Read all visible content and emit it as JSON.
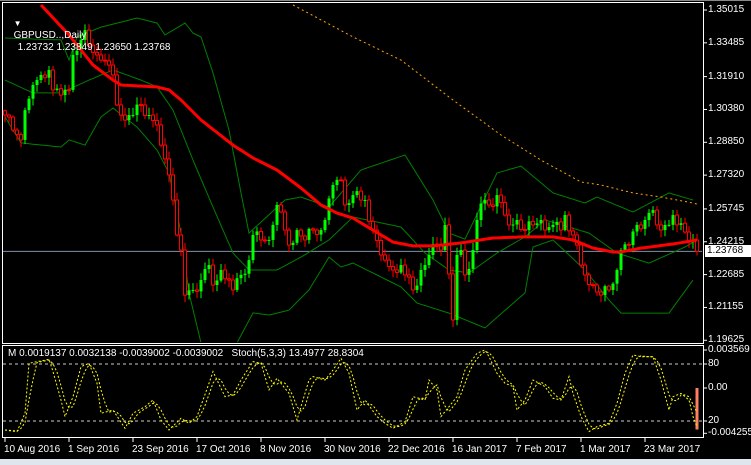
{
  "header": {
    "symbol": "GBPUSD..,Daily",
    "ohlc": "1.23732 1.23849 1.23650 1.23768",
    "menu_icon": "triangle-down-icon"
  },
  "indicator_label": "M 0.0019137 0.0032138 -0.0039002 -0.0039002   Stoch(5,3,3) 13.4977 28.8304",
  "current_price": "1.23768",
  "colors": {
    "bull": "#00ff00",
    "bear": "#ff0000",
    "ma": "#ff0000",
    "bands": "#008000",
    "ma_long": "#ffa500",
    "stoch": "#ffff00",
    "macd_hist": "#ff8060",
    "price_line": "#8090a8"
  },
  "chart_data": [
    {
      "type": "candlestick",
      "title": "GBPUSD..,Daily",
      "x_unit": "bar index (0 = 10 Aug 2016, 173 = last bar)",
      "ylim": [
        1.19625,
        1.35015
      ],
      "y_ticks": [
        "1.35015",
        "1.33485",
        "1.31910",
        "1.30380",
        "1.28850",
        "1.27320",
        "1.25745",
        "1.24215",
        "1.22685",
        "1.21155",
        "1.19625"
      ],
      "x_tick_labels": [
        "10 Aug 2016",
        "1 Sep 2016",
        "23 Sep 2016",
        "17 Oct 2016",
        "8 Nov 2016",
        "30 Nov 2016",
        "22 Dec 2016",
        "16 Jan 2017",
        "7 Feb 2017",
        "1 Mar 2017",
        "23 Mar 2017"
      ],
      "close_keypoints": [
        [
          0,
          1.3012
        ],
        [
          2,
          1.2942
        ],
        [
          4,
          1.2896
        ],
        [
          5,
          1.3035
        ],
        [
          7,
          1.3152
        ],
        [
          8,
          1.3175
        ],
        [
          11,
          1.3222
        ],
        [
          12,
          1.3129
        ],
        [
          14,
          1.3105
        ],
        [
          16,
          1.3129
        ],
        [
          17,
          1.3292
        ],
        [
          19,
          1.3362
        ],
        [
          20,
          1.3408
        ],
        [
          21,
          1.3338
        ],
        [
          23,
          1.3292
        ],
        [
          24,
          1.3268
        ],
        [
          26,
          1.3245
        ],
        [
          27,
          1.3199
        ],
        [
          28,
          1.3059
        ],
        [
          29,
          1.3012
        ],
        [
          31,
          1.3012
        ],
        [
          32,
          1.3012
        ],
        [
          34,
          1.3059
        ],
        [
          36,
          1.3012
        ],
        [
          38,
          1.2966
        ],
        [
          39,
          1.2872
        ],
        [
          41,
          1.2733
        ],
        [
          42,
          1.2616
        ],
        [
          43,
          1.2453
        ],
        [
          44,
          1.2383
        ],
        [
          45,
          1.2173
        ],
        [
          47,
          1.2197
        ],
        [
          49,
          1.2243
        ],
        [
          51,
          1.2313
        ],
        [
          52,
          1.222
        ],
        [
          54,
          1.229
        ],
        [
          56,
          1.2243
        ],
        [
          57,
          1.2197
        ],
        [
          59,
          1.2267
        ],
        [
          61,
          1.2336
        ],
        [
          62,
          1.2453
        ],
        [
          64,
          1.243
        ],
        [
          66,
          1.243
        ],
        [
          67,
          1.25
        ],
        [
          68,
          1.2593
        ],
        [
          70,
          1.2476
        ],
        [
          71,
          1.2406
        ],
        [
          73,
          1.2476
        ],
        [
          75,
          1.243
        ],
        [
          77,
          1.2476
        ],
        [
          79,
          1.2476
        ],
        [
          80,
          1.2523
        ],
        [
          82,
          1.2686
        ],
        [
          84,
          1.2709
        ],
        [
          85,
          1.2593
        ],
        [
          87,
          1.2639
        ],
        [
          89,
          1.2616
        ],
        [
          90,
          1.2616
        ],
        [
          92,
          1.2476
        ],
        [
          94,
          1.236
        ],
        [
          95,
          1.2336
        ],
        [
          97,
          1.229
        ],
        [
          99,
          1.2313
        ],
        [
          100,
          1.2267
        ],
        [
          102,
          1.2197
        ],
        [
          104,
          1.229
        ],
        [
          105,
          1.2313
        ],
        [
          106,
          1.236
        ],
        [
          108,
          1.2406
        ],
        [
          109,
          1.2383
        ],
        [
          110,
          1.25
        ],
        [
          112,
          1.2057
        ],
        [
          113,
          1.236
        ],
        [
          114,
          1.2383
        ],
        [
          115,
          1.2267
        ],
        [
          117,
          1.2383
        ],
        [
          118,
          1.2523
        ],
        [
          120,
          1.2616
        ],
        [
          121,
          1.2593
        ],
        [
          123,
          1.2639
        ],
        [
          125,
          1.2546
        ],
        [
          126,
          1.25
        ],
        [
          128,
          1.2523
        ],
        [
          130,
          1.2476
        ],
        [
          132,
          1.25
        ],
        [
          134,
          1.2523
        ],
        [
          135,
          1.2476
        ],
        [
          137,
          1.25
        ],
        [
          139,
          1.2476
        ],
        [
          140,
          1.2546
        ],
        [
          142,
          1.2453
        ],
        [
          144,
          1.2313
        ],
        [
          145,
          1.2267
        ],
        [
          147,
          1.222
        ],
        [
          149,
          1.2173
        ],
        [
          151,
          1.2197
        ],
        [
          153,
          1.229
        ],
        [
          154,
          1.2383
        ],
        [
          156,
          1.2406
        ],
        [
          158,
          1.25
        ],
        [
          160,
          1.2523
        ],
        [
          162,
          1.2569
        ],
        [
          163,
          1.25
        ],
        [
          164,
          1.2476
        ],
        [
          165,
          1.25
        ],
        [
          167,
          1.2546
        ],
        [
          168,
          1.25
        ],
        [
          170,
          1.2467
        ],
        [
          172,
          1.243
        ],
        [
          173,
          1.23768
        ]
      ],
      "ma": [
        [
          9,
          1.3525
        ],
        [
          16,
          1.3385
        ],
        [
          22,
          1.3245
        ],
        [
          27,
          1.3175
        ],
        [
          29,
          1.3152
        ],
        [
          38,
          1.3143
        ],
        [
          41,
          1.3129
        ],
        [
          44,
          1.3082
        ],
        [
          49,
          1.2989
        ],
        [
          57,
          1.2872
        ],
        [
          62,
          1.2812
        ],
        [
          68,
          1.2756
        ],
        [
          74,
          1.2672
        ],
        [
          79,
          1.2593
        ],
        [
          83,
          1.2555
        ],
        [
          87,
          1.2532
        ],
        [
          92,
          1.2476
        ],
        [
          97,
          1.242
        ],
        [
          102,
          1.2402
        ],
        [
          107,
          1.2402
        ],
        [
          114,
          1.2416
        ],
        [
          122,
          1.2439
        ],
        [
          129,
          1.2444
        ],
        [
          137,
          1.2444
        ],
        [
          142,
          1.243
        ],
        [
          147,
          1.2392
        ],
        [
          152,
          1.2374
        ],
        [
          154,
          1.2374
        ],
        [
          159,
          1.2392
        ],
        [
          167,
          1.2411
        ],
        [
          173,
          1.243
        ]
      ],
      "ma_long": [
        [
          72,
          1.3525
        ],
        [
          87,
          1.3376
        ],
        [
          99,
          1.3268
        ],
        [
          112,
          1.3082
        ],
        [
          124,
          1.2919
        ],
        [
          134,
          1.2802
        ],
        [
          144,
          1.27
        ],
        [
          149,
          1.2686
        ],
        [
          157,
          1.2649
        ],
        [
          164,
          1.263
        ],
        [
          172,
          1.2602
        ],
        [
          173,
          1.2597
        ]
      ],
      "bb_upper": [
        [
          0,
          1.3371
        ],
        [
          14,
          1.3362
        ],
        [
          16,
          1.3268
        ],
        [
          18,
          1.3376
        ],
        [
          24,
          1.3422
        ],
        [
          33,
          1.3464
        ],
        [
          38,
          1.3441
        ],
        [
          40,
          1.3385
        ],
        [
          45,
          1.3441
        ],
        [
          47,
          1.3394
        ],
        [
          49,
          1.3376
        ],
        [
          52,
          1.3208
        ],
        [
          56,
          1.2942
        ],
        [
          59,
          1.2649
        ],
        [
          61,
          1.2462
        ],
        [
          70,
          1.2616
        ],
        [
          74,
          1.263
        ],
        [
          81,
          1.2583
        ],
        [
          89,
          1.2756
        ],
        [
          100,
          1.2826
        ],
        [
          107,
          1.2616
        ],
        [
          111,
          1.2462
        ],
        [
          115,
          1.2434
        ],
        [
          123,
          1.2742
        ],
        [
          129,
          1.2774
        ],
        [
          137,
          1.2649
        ],
        [
          145,
          1.2602
        ],
        [
          148,
          1.263
        ],
        [
          157,
          1.256
        ],
        [
          166,
          1.2649
        ],
        [
          172,
          1.2616
        ]
      ],
      "bb_middle": [
        [
          0,
          1.3175
        ],
        [
          7,
          1.3115
        ],
        [
          14,
          1.3115
        ],
        [
          21,
          1.3175
        ],
        [
          27,
          1.3222
        ],
        [
          34,
          1.3175
        ],
        [
          38,
          1.3143
        ],
        [
          42,
          1.3035
        ],
        [
          47,
          1.2802
        ],
        [
          52,
          1.2583
        ],
        [
          57,
          1.2369
        ],
        [
          61,
          1.229
        ],
        [
          68,
          1.229
        ],
        [
          74,
          1.235
        ],
        [
          81,
          1.243
        ],
        [
          87,
          1.2537
        ],
        [
          99,
          1.249
        ],
        [
          105,
          1.2369
        ],
        [
          111,
          1.229
        ],
        [
          116,
          1.2276
        ],
        [
          123,
          1.2369
        ],
        [
          130,
          1.2444
        ],
        [
          135,
          1.2523
        ],
        [
          146,
          1.2462
        ],
        [
          153,
          1.2369
        ],
        [
          161,
          1.2322
        ],
        [
          170,
          1.2397
        ],
        [
          173,
          1.243
        ]
      ],
      "bb_lower": [
        [
          0,
          1.3003
        ],
        [
          4,
          1.2882
        ],
        [
          14,
          1.2863
        ],
        [
          16,
          1.2896
        ],
        [
          20,
          1.2872
        ],
        [
          24,
          1.3003
        ],
        [
          27,
          1.3045
        ],
        [
          33,
          1.2956
        ],
        [
          38,
          1.2849
        ],
        [
          41,
          1.2742
        ],
        [
          44,
          1.2462
        ],
        [
          46,
          1.2183
        ],
        [
          49,
          1.195
        ],
        [
          58,
          1.195
        ],
        [
          62,
          1.209
        ],
        [
          66,
          1.208
        ],
        [
          71,
          1.2103
        ],
        [
          76,
          1.2197
        ],
        [
          81,
          1.235
        ],
        [
          84,
          1.2304
        ],
        [
          87,
          1.2322
        ],
        [
          99,
          1.2211
        ],
        [
          103,
          1.2136
        ],
        [
          111,
          1.2089
        ],
        [
          120,
          1.202
        ],
        [
          130,
          1.2183
        ],
        [
          132,
          1.2397
        ],
        [
          137,
          1.243
        ],
        [
          145,
          1.229
        ],
        [
          151,
          1.215
        ],
        [
          154,
          1.2089
        ],
        [
          166,
          1.2089
        ],
        [
          172,
          1.2243
        ]
      ]
    },
    {
      "type": "line",
      "title": "Stoch(5,3,3) / MACD",
      "y_ticks": [
        "0.003569",
        "80",
        "0.00",
        "20",
        "-0.004255"
      ],
      "levels": [
        80,
        20
      ],
      "stoch_main": [
        [
          0,
          10.5
        ],
        [
          3,
          8.8
        ],
        [
          5,
          28.1
        ],
        [
          6,
          80.7
        ],
        [
          8,
          82.5
        ],
        [
          11,
          84.9
        ],
        [
          12,
          72
        ],
        [
          14,
          42.1
        ],
        [
          15,
          24.6
        ],
        [
          17,
          45.6
        ],
        [
          19,
          77.2
        ],
        [
          21,
          80.7
        ],
        [
          23,
          59.7
        ],
        [
          24,
          28.1
        ],
        [
          27,
          31.6
        ],
        [
          30,
          12.3
        ],
        [
          32,
          28.1
        ],
        [
          35,
          35.1
        ],
        [
          37,
          42.1
        ],
        [
          39,
          21.1
        ],
        [
          41,
          10.5
        ],
        [
          44,
          22.8
        ],
        [
          46,
          17.6
        ],
        [
          48,
          24.6
        ],
        [
          51,
          59.7
        ],
        [
          52,
          72
        ],
        [
          55,
          45.6
        ],
        [
          57,
          47.4
        ],
        [
          59,
          63.2
        ],
        [
          62,
          82.5
        ],
        [
          64,
          80.7
        ],
        [
          66,
          52.7
        ],
        [
          68,
          64.9
        ],
        [
          71,
          49.1
        ],
        [
          73,
          21.1
        ],
        [
          76,
          63.2
        ],
        [
          77,
          66.7
        ],
        [
          80,
          63.2
        ],
        [
          82,
          73.7
        ],
        [
          84,
          86
        ],
        [
          86,
          70.2
        ],
        [
          88,
          31.6
        ],
        [
          90,
          42.1
        ],
        [
          93,
          24.6
        ],
        [
          95,
          17.6
        ],
        [
          97,
          12.3
        ],
        [
          100,
          19.3
        ],
        [
          102,
          45.6
        ],
        [
          105,
          42.1
        ],
        [
          106,
          63.2
        ],
        [
          108,
          52.7
        ],
        [
          109,
          24.6
        ],
        [
          111,
          35.1
        ],
        [
          113,
          45.6
        ],
        [
          115,
          73.7
        ],
        [
          118,
          91.3
        ],
        [
          120,
          94.8
        ],
        [
          121,
          87.7
        ],
        [
          123,
          70.2
        ],
        [
          125,
          59.7
        ],
        [
          127,
          56.2
        ],
        [
          128,
          31.6
        ],
        [
          130,
          42.1
        ],
        [
          132,
          63.2
        ],
        [
          135,
          56.2
        ],
        [
          137,
          43.9
        ],
        [
          139,
          42.1
        ],
        [
          141,
          66.7
        ],
        [
          142,
          49.1
        ],
        [
          144,
          24.6
        ],
        [
          146,
          8.8
        ],
        [
          148,
          14.1
        ],
        [
          151,
          17.6
        ],
        [
          153,
          38.6
        ],
        [
          155,
          70.2
        ],
        [
          157,
          89.5
        ],
        [
          159,
          87.7
        ],
        [
          162,
          87.7
        ],
        [
          164,
          63.2
        ],
        [
          166,
          31.6
        ],
        [
          167,
          45.6
        ],
        [
          169,
          49.1
        ],
        [
          171,
          42.1
        ],
        [
          172,
          24.6
        ],
        [
          173,
          13.4977
        ]
      ],
      "stoch_signal_last": 28.8304,
      "macd_hist_last": -0.0039002
    }
  ]
}
